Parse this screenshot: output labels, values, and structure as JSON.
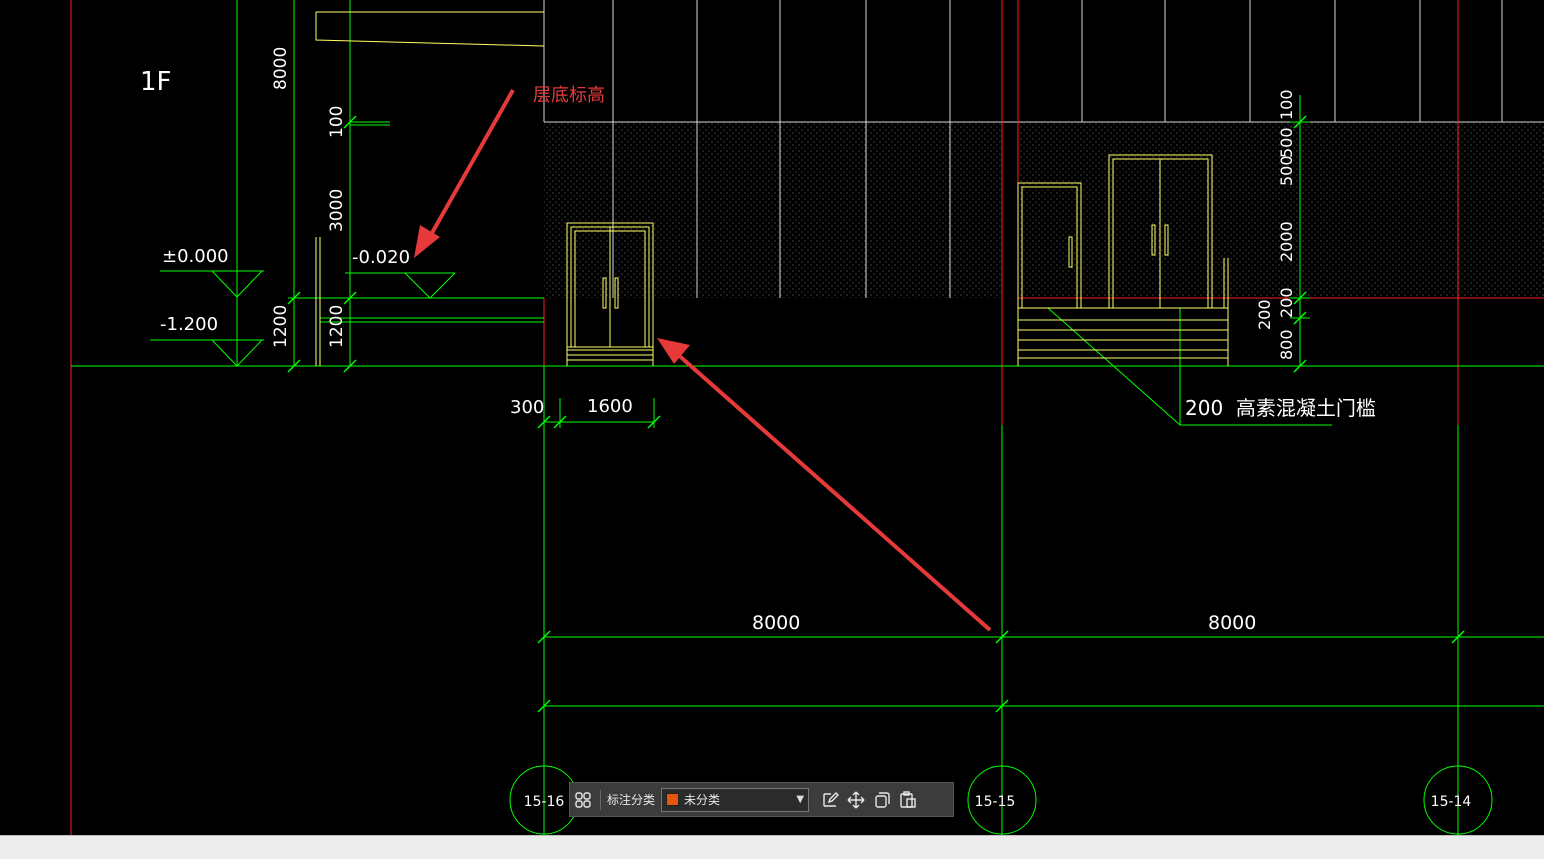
{
  "drawing": {
    "floor_label": "1F",
    "annotation_floor_base_elevation": "层底标高",
    "elevations": {
      "zero": "±0.000",
      "minus_1200": "-1.200",
      "minus_0020": "-0.020"
    },
    "vertical_dims": {
      "d8000": "8000",
      "d100": "100",
      "d3000": "3000",
      "d1200a": "1200",
      "d1200b": "1200"
    },
    "right_dims": {
      "d100": "100",
      "d500a": "500",
      "d500b": "500",
      "d2000": "2000",
      "d200a": "200",
      "d200b": "200",
      "d800": "800"
    },
    "horizontal_dims": {
      "d300": "300",
      "d1600": "1600",
      "span_left": "8000",
      "span_right": "8000"
    },
    "threshold_note": "200  高素混凝土门槛",
    "grid_axes": [
      "15-16",
      "15-15",
      "15-14"
    ]
  },
  "toolbar": {
    "category_label": "标注分类",
    "category_value": "未分类",
    "category_color": "#e8560e",
    "icons": [
      "layout-grid-icon",
      "edit-icon",
      "move-icon",
      "copy-icon",
      "paste-icon"
    ]
  },
  "colors": {
    "background": "#000000",
    "dimension": "#00ff00",
    "wall": "#ffffff",
    "door": "#ffff66",
    "axis": "#ff2020",
    "annotation_arrow": "#e63a3a"
  }
}
